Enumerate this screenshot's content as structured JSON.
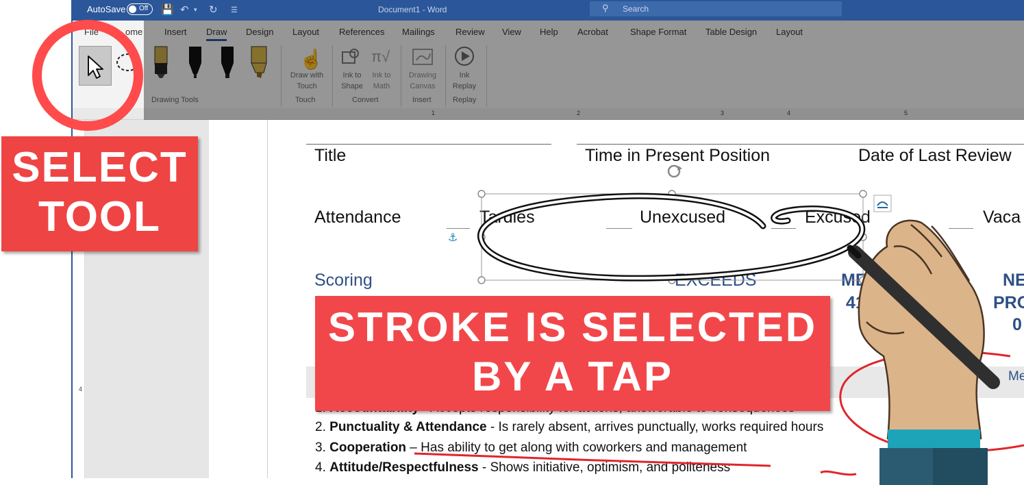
{
  "titlebar": {
    "autosave_label": "AutoSave",
    "autosave_state": "Off",
    "document_title": "Document1  -  Word",
    "search_placeholder": "Search"
  },
  "ribbon": {
    "tabs": [
      "File",
      "Home",
      "Insert",
      "Draw",
      "Design",
      "Layout",
      "References",
      "Mailings",
      "Review",
      "View",
      "Help",
      "Acrobat",
      "Shape Format",
      "Table Design",
      "Layout"
    ],
    "active_tab": "Draw",
    "file_tab_visible": "File",
    "home_tab_visible": "ome",
    "groups": {
      "drawing_tools": "Drawing Tools",
      "touch": "Touch",
      "convert": "Convert",
      "insert": "Insert",
      "replay": "Replay"
    },
    "buttons": {
      "draw_with_touch": [
        "Draw with",
        "Touch"
      ],
      "ink_to_shape": [
        "Ink to",
        "Shape"
      ],
      "ink_to_math": [
        "Ink to",
        "Math"
      ],
      "drawing_canvas": [
        "Drawing",
        "Canvas"
      ],
      "ink_replay": [
        "Ink",
        "Replay"
      ]
    }
  },
  "ruler": {
    "labels": [
      "1",
      "2",
      "3",
      "4",
      "5"
    ],
    "v_label": "4"
  },
  "document": {
    "header_fields": [
      "Title",
      "Time in Present Position",
      "Date of Last Review"
    ],
    "attendance_label": "Attendance",
    "attendance_options": [
      "Tardies",
      "Unexcused",
      "Excused",
      "Vaca"
    ],
    "scoring_label": "Scoring",
    "scoring_partials": [
      "EXCEEDS",
      "ME",
      "41",
      "NE",
      "PRO",
      "0"
    ],
    "meets_partial": "Me",
    "items": [
      {
        "num": "1.",
        "title": "Accountability",
        "desc": " - Accepts responsibility for actions, answerable to consequences"
      },
      {
        "num": "2.",
        "title": "Punctuality & Attendance",
        "desc": " - Is rarely absent, arrives punctually, works required hours"
      },
      {
        "num": "3.",
        "title": "Cooperation",
        "desc": " – Has ability to get along with coworkers and management"
      },
      {
        "num": "4.",
        "title": "Attitude/Respectfulness",
        "desc": " - Shows initiative, optimism, and politeness"
      }
    ]
  },
  "overlays": {
    "select_tool_lines": [
      "SELECT",
      "TOOL"
    ],
    "stroke_lines": [
      "STROKE IS SELECTED",
      "BY A TAP"
    ]
  },
  "colors": {
    "word_blue": "#2b579a",
    "annotation_red": "#ef4444",
    "heading_blue": "#2e4f86"
  },
  "icons": [
    "select-arrow-icon",
    "lasso-icon",
    "pen-icon",
    "highlighter-icon",
    "draw-with-touch-icon",
    "ink-to-shape-icon",
    "ink-to-math-icon",
    "drawing-canvas-icon",
    "ink-replay-icon",
    "rotate-handle-icon",
    "anchor-icon",
    "layout-options-icon",
    "save-icon",
    "undo-icon",
    "search-icon"
  ]
}
